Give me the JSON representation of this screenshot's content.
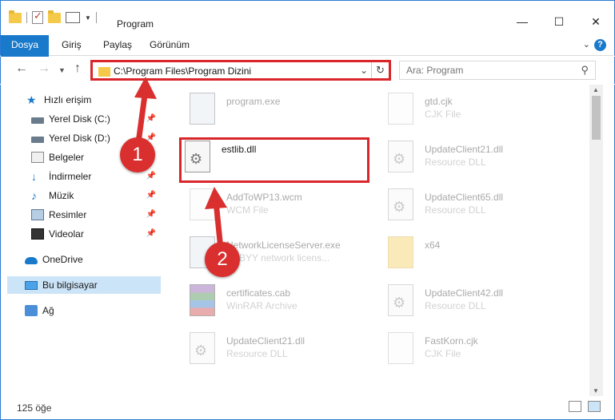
{
  "window": {
    "title": "Program",
    "controls": {
      "minimize": "—",
      "maximize": "☐",
      "close": "✕"
    }
  },
  "ribbon": {
    "tabs": [
      "Dosya",
      "Giriş",
      "Paylaş",
      "Görünüm"
    ],
    "help": "?"
  },
  "address": {
    "path": "C:\\Program Files\\Program Dizini"
  },
  "search": {
    "placeholder": "Ara: Program"
  },
  "sidebar": {
    "items": [
      {
        "label": "Hızlı erişim"
      },
      {
        "label": "Yerel Disk (C:)"
      },
      {
        "label": "Yerel Disk (D:)"
      },
      {
        "label": "Belgeler"
      },
      {
        "label": "İndirmeler"
      },
      {
        "label": "Müzik"
      },
      {
        "label": "Resimler"
      },
      {
        "label": "Videolar"
      },
      {
        "label": "OneDrive"
      },
      {
        "label": "Bu bilgisayar"
      },
      {
        "label": "Ağ"
      }
    ]
  },
  "files": [
    {
      "name": "program.exe",
      "sub": ""
    },
    {
      "name": "gtd.cjk",
      "sub": "CJK File"
    },
    {
      "name": "estlib.dll",
      "sub": ""
    },
    {
      "name": "UpdateClient21.dll",
      "sub": "Resource DLL"
    },
    {
      "name": "AddToWP13.wcm",
      "sub": "WCM File"
    },
    {
      "name": "UpdateClient65.dll",
      "sub": "Resource DLL"
    },
    {
      "name": "NetworkLicenseServer.exe",
      "sub": "ABBYY network licens..."
    },
    {
      "name": "x64",
      "sub": ""
    },
    {
      "name": "certificates.cab",
      "sub": "WinRAR Archive"
    },
    {
      "name": "UpdateClient42.dll",
      "sub": "Resource DLL"
    },
    {
      "name": "UpdateClient21.dll",
      "sub": "Resource DLL"
    },
    {
      "name": "FastKorn.cjk",
      "sub": "CJK File"
    }
  ],
  "status": {
    "count": "125 öğe"
  },
  "annotations": {
    "step1": "1",
    "step2": "2",
    "color": "#d9262a"
  }
}
